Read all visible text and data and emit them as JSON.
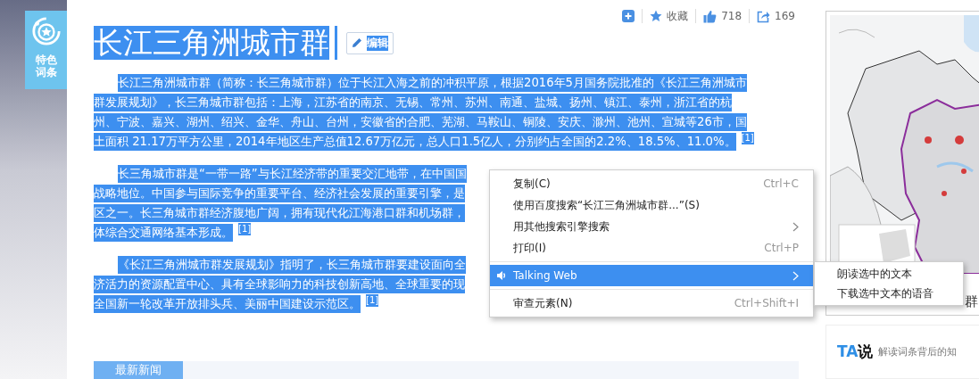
{
  "badge": {
    "label": "特色词条"
  },
  "toolbar": {
    "favorite": "收藏",
    "likes": "718",
    "shares": "169"
  },
  "title": "长江三角洲城市群",
  "edit_button": "编辑",
  "paragraphs": [
    {
      "lines": [
        "长江三角洲城市群（简称：长三角城市群）位于长江入海之前的冲积平原，根据2016年5月国务院批准的《长江三角洲城市",
        "群发展规划》，长三角城市群包括：上海，江苏省的南京、无锡、常州、苏州、南通、盐城、扬州、镇江、泰州，浙江省的杭",
        "州、宁波、嘉兴、湖州、绍兴、金华、舟山、台州，安徽省的合肥、芜湖、马鞍山、铜陵、安庆、滁州、池州、宣城等26市，国",
        "土面积 21.17万平方公里，2014年地区生产总值12.67万亿元，总人口1.5亿人，分别约占全国的2.2%、18.5%、11.0%。"
      ],
      "footnote": "[1]"
    },
    {
      "lines": [
        "长三角城市群是“一带一路”与长江经济带的重要交汇地带，在中国国",
        "战略地位。中国参与国际竞争的重要平台、经济社会发展的重要引擎，是",
        "区之一。长三角城市群经济腹地广阔，拥有现代化江海港口群和机场群，",
        "体综合交通网络基本形成。"
      ],
      "footnote": "[1]"
    },
    {
      "lines": [
        "《长江三角洲城市群发展规划》指明了，长三角城市群要建设面向全",
        "济活力的资源配置中心、具有全球影响力的科技创新高地、全球重要的现",
        "全国新一轮改革开放排头兵、美丽中国建设示范区。"
      ],
      "footnote": "[1]"
    }
  ],
  "news_tab": "最新新闻",
  "map_caption": "群",
  "ta_card": {
    "logo_mark": "TA",
    "logo_word": "说",
    "tagline": "解读词条背后的知"
  },
  "context_menu": {
    "items": [
      {
        "kind": "command",
        "label": "复制(C)",
        "shortcut": "Ctrl+C",
        "has_submenu": false,
        "selected": false
      },
      {
        "kind": "command",
        "label": "使用百度搜索“长江三角洲城市群...”(S)",
        "has_submenu": false,
        "selected": false
      },
      {
        "kind": "command",
        "label": "用其他搜索引擎搜索",
        "has_submenu": true,
        "selected": false
      },
      {
        "kind": "command",
        "label": "打印(I)",
        "shortcut": "Ctrl+P",
        "has_submenu": false,
        "selected": false
      },
      {
        "kind": "separator"
      },
      {
        "kind": "extension",
        "label": "Talking Web",
        "has_submenu": true,
        "selected": true
      },
      {
        "kind": "separator"
      },
      {
        "kind": "command",
        "label": "审查元素(N)",
        "shortcut": "Ctrl+Shift+I",
        "has_submenu": false,
        "selected": false
      }
    ]
  },
  "submenu": {
    "items": [
      {
        "label": "朗读选中的文本",
        "selected": false
      },
      {
        "label": "下载选中文本的语音",
        "selected": false
      }
    ]
  }
}
